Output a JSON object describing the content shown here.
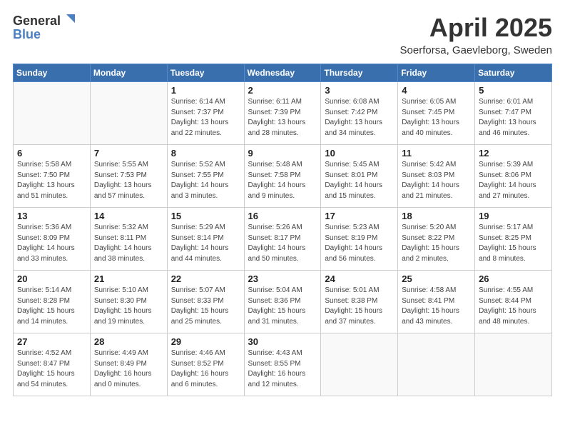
{
  "header": {
    "logo_general": "General",
    "logo_blue": "Blue",
    "month": "April 2025",
    "location": "Soerforsa, Gaevleborg, Sweden"
  },
  "weekdays": [
    "Sunday",
    "Monday",
    "Tuesday",
    "Wednesday",
    "Thursday",
    "Friday",
    "Saturday"
  ],
  "weeks": [
    [
      {
        "day": "",
        "info": ""
      },
      {
        "day": "",
        "info": ""
      },
      {
        "day": "1",
        "info": "Sunrise: 6:14 AM\nSunset: 7:37 PM\nDaylight: 13 hours\nand 22 minutes."
      },
      {
        "day": "2",
        "info": "Sunrise: 6:11 AM\nSunset: 7:39 PM\nDaylight: 13 hours\nand 28 minutes."
      },
      {
        "day": "3",
        "info": "Sunrise: 6:08 AM\nSunset: 7:42 PM\nDaylight: 13 hours\nand 34 minutes."
      },
      {
        "day": "4",
        "info": "Sunrise: 6:05 AM\nSunset: 7:45 PM\nDaylight: 13 hours\nand 40 minutes."
      },
      {
        "day": "5",
        "info": "Sunrise: 6:01 AM\nSunset: 7:47 PM\nDaylight: 13 hours\nand 46 minutes."
      }
    ],
    [
      {
        "day": "6",
        "info": "Sunrise: 5:58 AM\nSunset: 7:50 PM\nDaylight: 13 hours\nand 51 minutes."
      },
      {
        "day": "7",
        "info": "Sunrise: 5:55 AM\nSunset: 7:53 PM\nDaylight: 13 hours\nand 57 minutes."
      },
      {
        "day": "8",
        "info": "Sunrise: 5:52 AM\nSunset: 7:55 PM\nDaylight: 14 hours\nand 3 minutes."
      },
      {
        "day": "9",
        "info": "Sunrise: 5:48 AM\nSunset: 7:58 PM\nDaylight: 14 hours\nand 9 minutes."
      },
      {
        "day": "10",
        "info": "Sunrise: 5:45 AM\nSunset: 8:01 PM\nDaylight: 14 hours\nand 15 minutes."
      },
      {
        "day": "11",
        "info": "Sunrise: 5:42 AM\nSunset: 8:03 PM\nDaylight: 14 hours\nand 21 minutes."
      },
      {
        "day": "12",
        "info": "Sunrise: 5:39 AM\nSunset: 8:06 PM\nDaylight: 14 hours\nand 27 minutes."
      }
    ],
    [
      {
        "day": "13",
        "info": "Sunrise: 5:36 AM\nSunset: 8:09 PM\nDaylight: 14 hours\nand 33 minutes."
      },
      {
        "day": "14",
        "info": "Sunrise: 5:32 AM\nSunset: 8:11 PM\nDaylight: 14 hours\nand 38 minutes."
      },
      {
        "day": "15",
        "info": "Sunrise: 5:29 AM\nSunset: 8:14 PM\nDaylight: 14 hours\nand 44 minutes."
      },
      {
        "day": "16",
        "info": "Sunrise: 5:26 AM\nSunset: 8:17 PM\nDaylight: 14 hours\nand 50 minutes."
      },
      {
        "day": "17",
        "info": "Sunrise: 5:23 AM\nSunset: 8:19 PM\nDaylight: 14 hours\nand 56 minutes."
      },
      {
        "day": "18",
        "info": "Sunrise: 5:20 AM\nSunset: 8:22 PM\nDaylight: 15 hours\nand 2 minutes."
      },
      {
        "day": "19",
        "info": "Sunrise: 5:17 AM\nSunset: 8:25 PM\nDaylight: 15 hours\nand 8 minutes."
      }
    ],
    [
      {
        "day": "20",
        "info": "Sunrise: 5:14 AM\nSunset: 8:28 PM\nDaylight: 15 hours\nand 14 minutes."
      },
      {
        "day": "21",
        "info": "Sunrise: 5:10 AM\nSunset: 8:30 PM\nDaylight: 15 hours\nand 19 minutes."
      },
      {
        "day": "22",
        "info": "Sunrise: 5:07 AM\nSunset: 8:33 PM\nDaylight: 15 hours\nand 25 minutes."
      },
      {
        "day": "23",
        "info": "Sunrise: 5:04 AM\nSunset: 8:36 PM\nDaylight: 15 hours\nand 31 minutes."
      },
      {
        "day": "24",
        "info": "Sunrise: 5:01 AM\nSunset: 8:38 PM\nDaylight: 15 hours\nand 37 minutes."
      },
      {
        "day": "25",
        "info": "Sunrise: 4:58 AM\nSunset: 8:41 PM\nDaylight: 15 hours\nand 43 minutes."
      },
      {
        "day": "26",
        "info": "Sunrise: 4:55 AM\nSunset: 8:44 PM\nDaylight: 15 hours\nand 48 minutes."
      }
    ],
    [
      {
        "day": "27",
        "info": "Sunrise: 4:52 AM\nSunset: 8:47 PM\nDaylight: 15 hours\nand 54 minutes."
      },
      {
        "day": "28",
        "info": "Sunrise: 4:49 AM\nSunset: 8:49 PM\nDaylight: 16 hours\nand 0 minutes."
      },
      {
        "day": "29",
        "info": "Sunrise: 4:46 AM\nSunset: 8:52 PM\nDaylight: 16 hours\nand 6 minutes."
      },
      {
        "day": "30",
        "info": "Sunrise: 4:43 AM\nSunset: 8:55 PM\nDaylight: 16 hours\nand 12 minutes."
      },
      {
        "day": "",
        "info": ""
      },
      {
        "day": "",
        "info": ""
      },
      {
        "day": "",
        "info": ""
      }
    ]
  ]
}
